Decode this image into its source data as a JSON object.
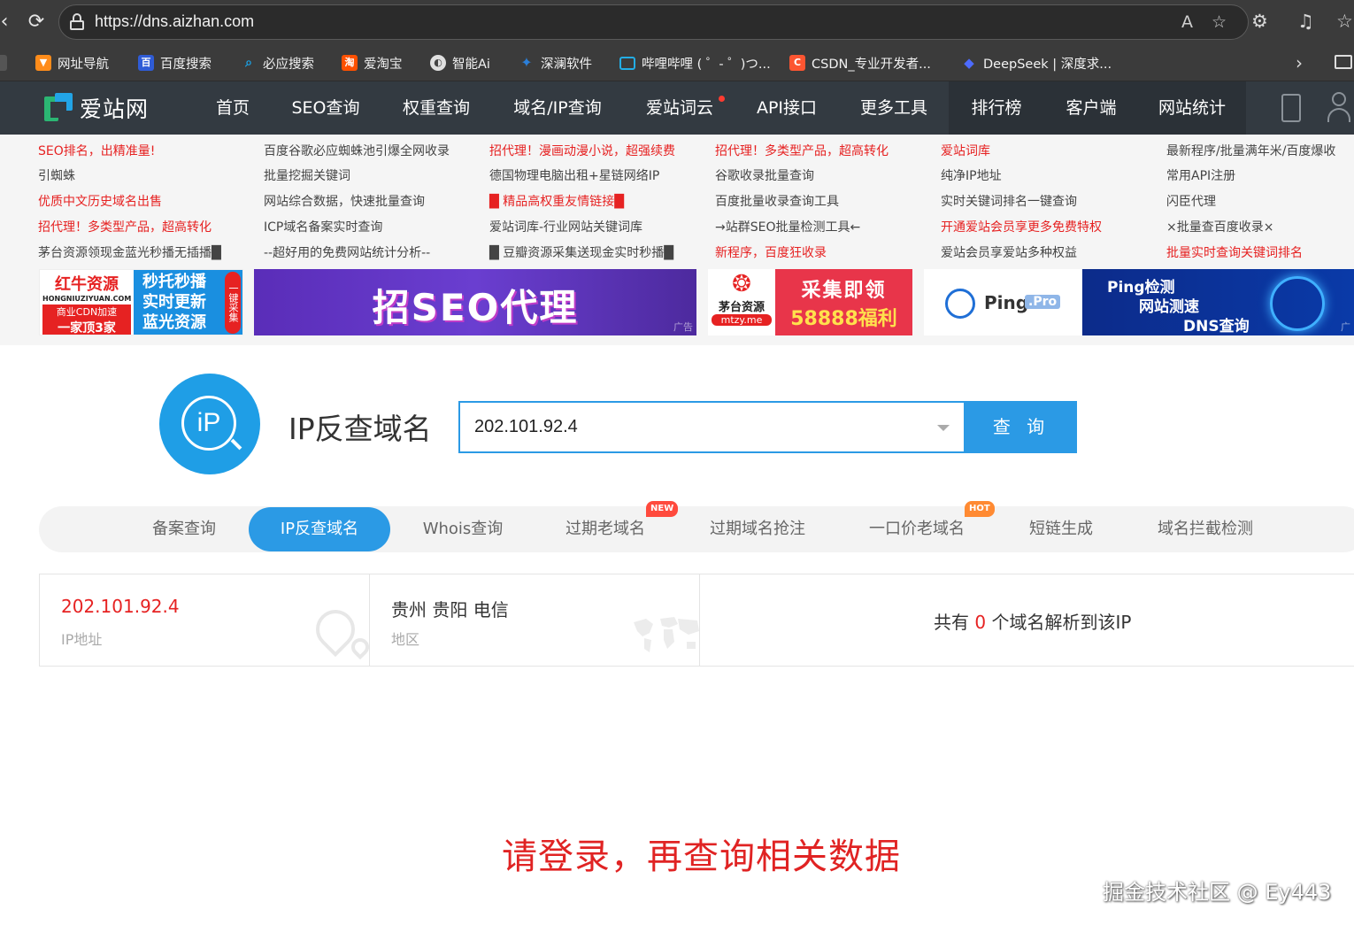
{
  "browser": {
    "url": "https://dns.aizhan.com",
    "bookmarks": [
      {
        "label": "网址导航",
        "color": "#ff8c1a"
      },
      {
        "label": "百度搜索",
        "color": "#2f5cd6"
      },
      {
        "label": "必应搜索",
        "color": "#1aa3e8"
      },
      {
        "label": "爱淘宝",
        "color": "#ff5000"
      },
      {
        "label": "智能Ai",
        "color": "#8a8a8a"
      },
      {
        "label": "深澜软件",
        "color": "#2b7fd9"
      },
      {
        "label": "哔哩哔哩 ( ゜- ゜)つ...",
        "color": "#23ade5"
      },
      {
        "label": "CSDN_专业开发者...",
        "color": "#fc5531"
      },
      {
        "label": "DeepSeek | 深度求...",
        "color": "#4d6bfe"
      }
    ]
  },
  "site": {
    "logo_text": "爱站网",
    "menu": [
      "首页",
      "SEO查询",
      "权重查询",
      "域名/IP查询",
      "爱站词云",
      "API接口",
      "更多工具",
      "排行榜",
      "客户端",
      "网站统计"
    ]
  },
  "links": {
    "col1": [
      "SEO排名，出精准量!",
      "引蜘蛛",
      "优质中文历史域名出售",
      "招代理！多类型产品，超高转化",
      "茅台资源领现金蓝光秒播无插播█"
    ],
    "col2": [
      "百度谷歌必应蜘蛛池引爆全网收录",
      "批量挖掘关键词",
      "网站综合数据，快速批量查询",
      "ICP域名备案实时查询",
      "--超好用的免费网站统计分析--"
    ],
    "col3": [
      "招代理！漫画动漫小说，超强续费",
      "德国物理电脑出租+星链网络IP",
      "█ 精品高权重友情链接█",
      "爱站词库-行业网站关键词库",
      "█ 豆瓣资源采集送现金实时秒播█"
    ],
    "col4": [
      "招代理！多类型产品，超高转化",
      "谷歌收录批量查询",
      "百度批量收录查询工具",
      "→站群SEO批量检测工具←",
      "新程序，百度狂收录"
    ],
    "col5": [
      "爱站词库",
      "纯净IP地址",
      "实时关键词排名一键查询",
      "开通爱站会员享更多免费特权",
      "爱站会员享爱站多种权益"
    ],
    "col6": [
      "最新程序/批量满年米/百度爆收",
      "常用API注册",
      "闪臣代理",
      "×批量查百度收录×",
      "批量实时查询关键词排名"
    ]
  },
  "banners": {
    "b1_l1": "红牛资源",
    "b1_site": "HONGNIUZIYUAN.COM",
    "b1_l2": "商业CDN加速",
    "b1_l3": "一家顶3家",
    "b1_r1": "秒托秒播",
    "b1_r2": "实时更新",
    "b1_r3": "蓝光资源",
    "b1_side": "一键采集",
    "b2_text": "招SEO代理",
    "b2_ad": "广告",
    "b3_name": "茅台资源",
    "b3_site": "mtzy.me",
    "b3_t1": "采集即领",
    "b3_t2": "58888福利",
    "b4_ping": "Ping",
    "b4_pro": ".Pro",
    "b5_l1": "Ping检测",
    "b5_l2": "网站测速",
    "b5_l3": "DNS查询",
    "b5_ad": "广"
  },
  "search": {
    "title": "IP反查域名",
    "value": "202.101.92.4",
    "button": "查 询"
  },
  "tabs": [
    {
      "label": "备案查询",
      "active": false
    },
    {
      "label": "IP反查域名",
      "active": true
    },
    {
      "label": "Whois查询",
      "active": false
    },
    {
      "label": "过期老域名",
      "active": false,
      "badge": "NEW"
    },
    {
      "label": "过期域名抢注",
      "active": false
    },
    {
      "label": "一口价老域名",
      "active": false,
      "badge": "HOT"
    },
    {
      "label": "短链生成",
      "active": false
    },
    {
      "label": "域名拦截检测",
      "active": false
    }
  ],
  "result": {
    "ip": "202.101.92.4",
    "ip_label": "IP地址",
    "region": "贵州 贵阳 电信",
    "region_label": "地区",
    "count_prefix": "共有",
    "count": "0",
    "count_suffix": "个域名解析到该IP"
  },
  "login_message": "请登录，再查询相关数据",
  "watermark": "掘金技术社区 @ Ey443"
}
